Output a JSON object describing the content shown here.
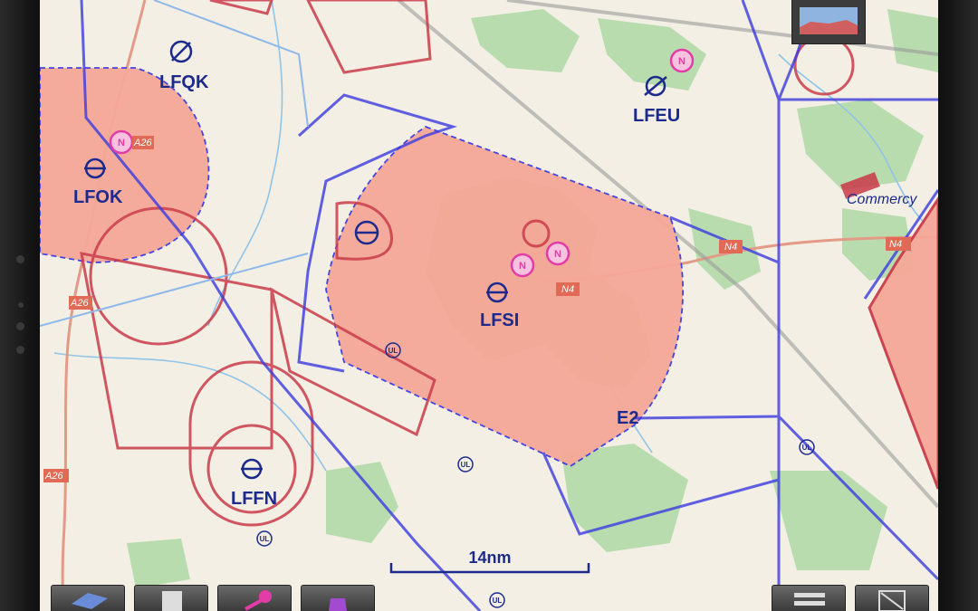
{
  "map": {
    "airfields": {
      "lfqk": "LFQK",
      "lfok": "LFOK",
      "lfeu": "LFEU",
      "lfsi": "LFSI",
      "lffn": "LFFN",
      "e2": "E2"
    },
    "towns": {
      "commercy": "Commercy"
    },
    "roads": {
      "a26_top": "A26",
      "a26_mid": "A26",
      "a26_bottom": "A26",
      "n4_center": "N4",
      "n4_east": "N4",
      "n4_far": "N4"
    },
    "scale_bar": {
      "label": "14nm"
    },
    "ul_marker": "UL",
    "vor_marker": "N"
  },
  "toolbar": {
    "buttons": [
      "layers-button",
      "calculator-button",
      "route-button",
      "airport-button",
      "menu-button",
      "fullscreen-button"
    ]
  },
  "colors": {
    "background": "#f3efe4",
    "restricted_fill": "#f6a898",
    "restricted_line": "#c93b4a",
    "airspace_blue": "#3b3be0",
    "forest": "#b9dcaf",
    "water": "#8fc4e8",
    "vor_magenta": "#e23ca6"
  }
}
